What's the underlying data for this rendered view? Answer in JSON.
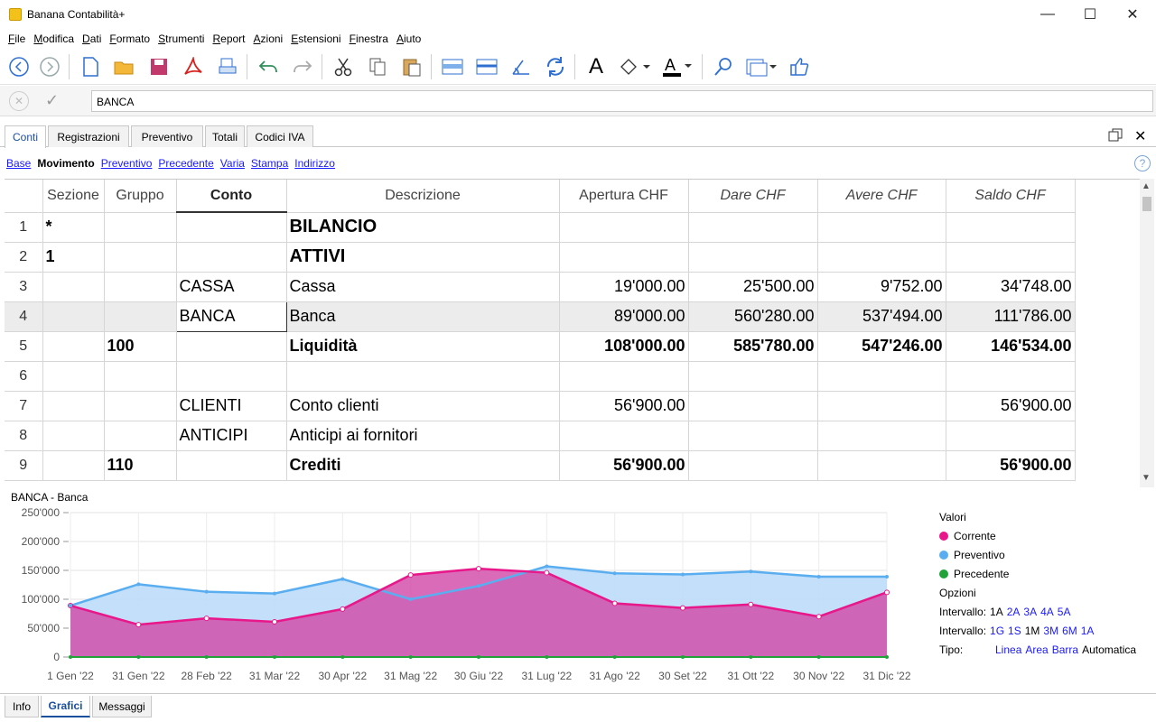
{
  "window": {
    "title": "Banana Contabilità+"
  },
  "menu": [
    "File",
    "Modifica",
    "Dati",
    "Formato",
    "Strumenti",
    "Report",
    "Azioni",
    "Estensioni",
    "Finestra",
    "Aiuto"
  ],
  "editbar": {
    "value": "BANCA"
  },
  "tabs": [
    "Conti",
    "Registrazioni",
    "Preventivo",
    "Totali",
    "Codici IVA"
  ],
  "views": {
    "items": [
      "Base",
      "Movimento",
      "Preventivo",
      "Precedente",
      "Varia",
      "Stampa",
      "Indirizzo"
    ],
    "active": "Movimento"
  },
  "table": {
    "headers": [
      "Sezione",
      "Gruppo",
      "Conto",
      "Descrizione",
      "Apertura CHF",
      "Dare CHF",
      "Avere CHF",
      "Saldo CHF"
    ],
    "rows": [
      {
        "n": "1",
        "sezione": "*",
        "gruppo": "",
        "conto": "",
        "descrizione": "BILANCIO",
        "apertura": "",
        "dare": "",
        "avere": "",
        "saldo": ""
      },
      {
        "n": "2",
        "sezione": "1",
        "gruppo": "",
        "conto": "",
        "descrizione": "ATTIVI",
        "apertura": "",
        "dare": "",
        "avere": "",
        "saldo": ""
      },
      {
        "n": "3",
        "sezione": "",
        "gruppo": "",
        "conto": "CASSA",
        "descrizione": "Cassa",
        "apertura": "19'000.00",
        "dare": "25'500.00",
        "avere": "9'752.00",
        "saldo": "34'748.00"
      },
      {
        "n": "4",
        "sezione": "",
        "gruppo": "",
        "conto": "BANCA",
        "descrizione": "Banca",
        "apertura": "89'000.00",
        "dare": "560'280.00",
        "avere": "537'494.00",
        "saldo": "111'786.00"
      },
      {
        "n": "5",
        "sezione": "",
        "gruppo": "100",
        "conto": "",
        "descrizione": "Liquidità",
        "apertura": "108'000.00",
        "dare": "585'780.00",
        "avere": "547'246.00",
        "saldo": "146'534.00"
      },
      {
        "n": "6",
        "sezione": "",
        "gruppo": "",
        "conto": "",
        "descrizione": "",
        "apertura": "",
        "dare": "",
        "avere": "",
        "saldo": ""
      },
      {
        "n": "7",
        "sezione": "",
        "gruppo": "",
        "conto": "CLIENTI",
        "descrizione": "Conto clienti",
        "apertura": "56'900.00",
        "dare": "",
        "avere": "",
        "saldo": "56'900.00"
      },
      {
        "n": "8",
        "sezione": "",
        "gruppo": "",
        "conto": "ANTICIPI",
        "descrizione": "Anticipi ai fornitori",
        "apertura": "",
        "dare": "",
        "avere": "",
        "saldo": ""
      },
      {
        "n": "9",
        "sezione": "",
        "gruppo": "110",
        "conto": "",
        "descrizione": "Crediti",
        "apertura": "56'900.00",
        "dare": "",
        "avere": "",
        "saldo": "56'900.00"
      }
    ]
  },
  "chart_panel": {
    "title": "BANCA - Banca"
  },
  "chart_data": {
    "type": "area",
    "categories": [
      "1 Gen '22",
      "31 Gen '22",
      "28 Feb '22",
      "31 Mar '22",
      "30 Apr '22",
      "31 Mag '22",
      "30 Giu '22",
      "31 Lug '22",
      "31 Ago '22",
      "30 Set '22",
      "31 Ott '22",
      "30 Nov '22",
      "31 Dic '22"
    ],
    "yticks": [
      "0",
      "50'000",
      "100'000",
      "150'000",
      "200'000",
      "250'000"
    ],
    "ylim": [
      0,
      250000
    ],
    "series": [
      {
        "name": "Corrente",
        "color": "#e8178a",
        "values": [
          89000,
          56000,
          67000,
          61000,
          83000,
          142000,
          153000,
          146000,
          93000,
          85000,
          91000,
          70000,
          112000
        ]
      },
      {
        "name": "Preventivo",
        "color": "#5aaef0",
        "values": [
          89000,
          126000,
          113000,
          110000,
          135000,
          100000,
          123000,
          157000,
          145000,
          143000,
          148000,
          139000,
          139000
        ]
      },
      {
        "name": "Precedente",
        "color": "#22a33a",
        "values": [
          0,
          0,
          0,
          0,
          0,
          0,
          0,
          0,
          0,
          0,
          0,
          0,
          0
        ]
      }
    ]
  },
  "legend": {
    "values_title": "Valori",
    "options_title": "Opzioni",
    "interval1_label": "Intervallo:",
    "interval1": [
      "1A",
      "2A",
      "3A",
      "4A",
      "5A"
    ],
    "interval2_label": "Intervallo:",
    "interval2": [
      "1G",
      "1S",
      "1M",
      "3M",
      "6M",
      "1A"
    ],
    "type_label": "Tipo:",
    "types": [
      "Linea",
      "Area",
      "Barra",
      "Automatica"
    ]
  },
  "bottom_tabs": [
    "Info",
    "Grafici",
    "Messaggi"
  ]
}
